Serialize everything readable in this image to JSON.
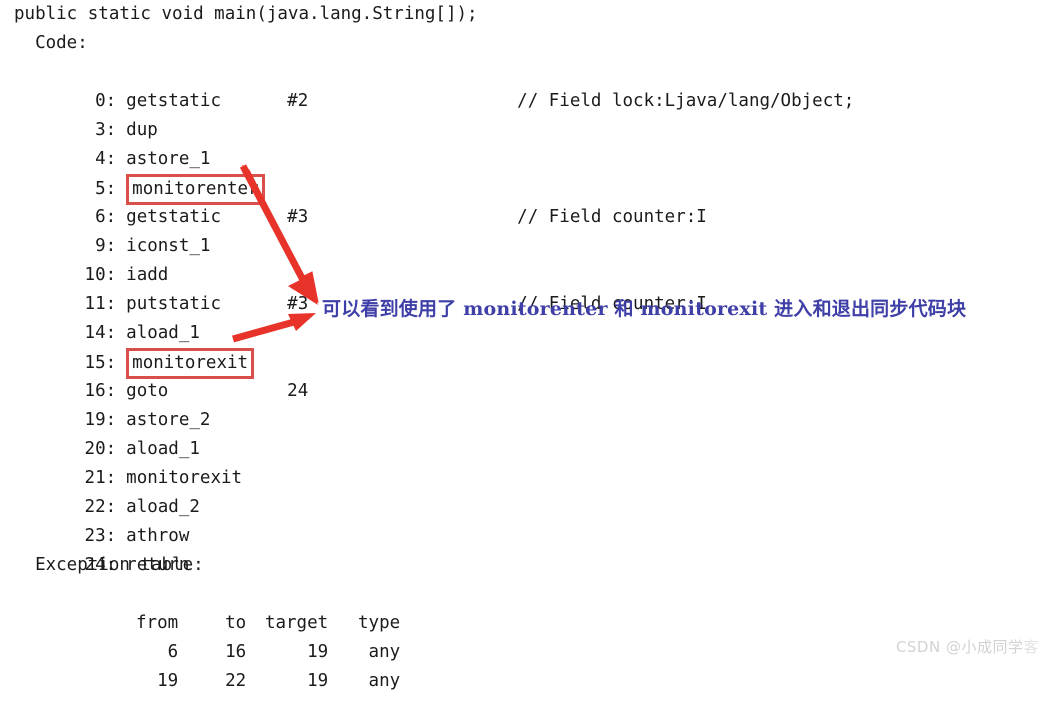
{
  "document": {
    "background_color": "#ffffff",
    "text_color": "#1b1b1b",
    "method_signature": "public static void main(java.lang.String[]);",
    "code_label": "  Code:"
  },
  "code": {
    "lines": [
      {
        "pc": "0:",
        "mnemonic": "getstatic",
        "operand": "#2",
        "comment": "// Field lock:Ljava/lang/Object;",
        "boxed": false
      },
      {
        "pc": "3:",
        "mnemonic": "dup",
        "operand": "",
        "comment": "",
        "boxed": false
      },
      {
        "pc": "4:",
        "mnemonic": "astore_1",
        "operand": "",
        "comment": "",
        "boxed": false
      },
      {
        "pc": "5:",
        "mnemonic": "monitorenter",
        "operand": "",
        "comment": "",
        "boxed": true
      },
      {
        "pc": "6:",
        "mnemonic": "getstatic",
        "operand": "#3",
        "comment": "// Field counter:I",
        "boxed": false
      },
      {
        "pc": "9:",
        "mnemonic": "iconst_1",
        "operand": "",
        "comment": "",
        "boxed": false
      },
      {
        "pc": "10:",
        "mnemonic": "iadd",
        "operand": "",
        "comment": "",
        "boxed": false
      },
      {
        "pc": "11:",
        "mnemonic": "putstatic",
        "operand": "#3",
        "comment": "// Field counter:I",
        "boxed": false
      },
      {
        "pc": "14:",
        "mnemonic": "aload_1",
        "operand": "",
        "comment": "",
        "boxed": false
      },
      {
        "pc": "15:",
        "mnemonic": "monitorexit",
        "operand": "",
        "comment": "",
        "boxed": true
      },
      {
        "pc": "16:",
        "mnemonic": "goto",
        "operand": "24",
        "comment": "",
        "boxed": false
      },
      {
        "pc": "19:",
        "mnemonic": "astore_2",
        "operand": "",
        "comment": "",
        "boxed": false
      },
      {
        "pc": "20:",
        "mnemonic": "aload_1",
        "operand": "",
        "comment": "",
        "boxed": false
      },
      {
        "pc": "21:",
        "mnemonic": "monitorexit",
        "operand": "",
        "comment": "",
        "boxed": false
      },
      {
        "pc": "22:",
        "mnemonic": "aload_2",
        "operand": "",
        "comment": "",
        "boxed": false
      },
      {
        "pc": "23:",
        "mnemonic": "athrow",
        "operand": "",
        "comment": "",
        "boxed": false
      },
      {
        "pc": "24:",
        "mnemonic": "return",
        "operand": "",
        "comment": "",
        "boxed": false
      }
    ]
  },
  "exception_table": {
    "title": "  Exception table:",
    "headers": [
      "from",
      "to",
      "target",
      "type"
    ],
    "rows": [
      [
        "6",
        "16",
        "19",
        "any"
      ],
      [
        "19",
        "22",
        "19",
        "any"
      ]
    ]
  },
  "annotation": {
    "text": "可以看到使用了 monitorenter 和 monitorexit 进入和退出同步代码块",
    "color": "#3f3fa8"
  },
  "highlights": {
    "box_color": "#d94f4a",
    "arrow_color": "#e8332a",
    "boxed_opcodes": [
      "monitorenter",
      "monitorexit"
    ]
  },
  "watermark": {
    "text": "CSDN @小成同学",
    "sub_text": "客",
    "color": "#d2d2d2"
  }
}
